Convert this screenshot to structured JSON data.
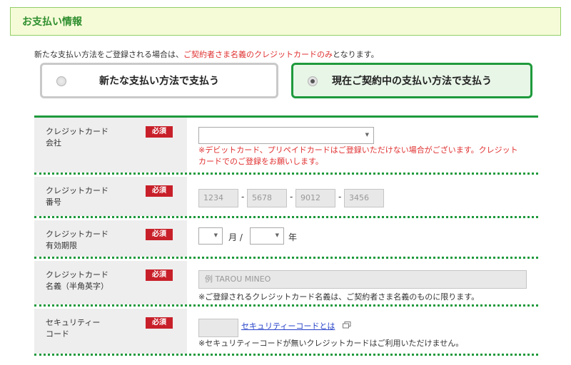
{
  "section": {
    "title": "お支払い情報"
  },
  "notice": {
    "prefix": "新たな支払い方法をご登録される場合は、",
    "highlight": "ご契約者さま名義のクレジットカードのみ",
    "suffix": "となります。"
  },
  "payment_options": [
    {
      "label": "新たな支払い方法で支払う",
      "selected": false
    },
    {
      "label": "現在ご契約中の支払い方法で支払う",
      "selected": true
    }
  ],
  "required_badge": "必須",
  "form": {
    "card_company": {
      "label_line1": "クレジットカード",
      "label_line2": "会社",
      "selected_value": "",
      "error_line1": "※デビットカード、プリペイドカードはご登録いただけない場合がございます。クレジット",
      "error_line2": "カードでのご登録をお願いします。"
    },
    "card_number": {
      "label_line1": "クレジットカード",
      "label_line2": "番号",
      "placeholders": [
        "1234",
        "5678",
        "9012",
        "3456"
      ],
      "separator": "-"
    },
    "expiry": {
      "label_line1": "クレジットカード",
      "label_line2": "有効期限",
      "month_unit": "月 /",
      "year_unit": "年"
    },
    "card_name": {
      "label_line1": "クレジットカード",
      "label_line2": "名義（半角英字）",
      "placeholder": "例 TAROU MINEO",
      "note": "※ご登録されるクレジットカード名義は、ご契約者さま名義のものに限ります。"
    },
    "security_code": {
      "label_line1": "セキュリティー",
      "label_line2": "コード",
      "link_text": "セキュリティーコードとは",
      "note": "※セキュリティーコードが無いクレジットカードはご利用いただけません。"
    }
  },
  "colors": {
    "accent_green": "#1e9a3c",
    "required_red": "#c8202a",
    "error_red": "#e03030",
    "header_bg": "#f6fbd7",
    "link_blue": "#2440c8"
  }
}
